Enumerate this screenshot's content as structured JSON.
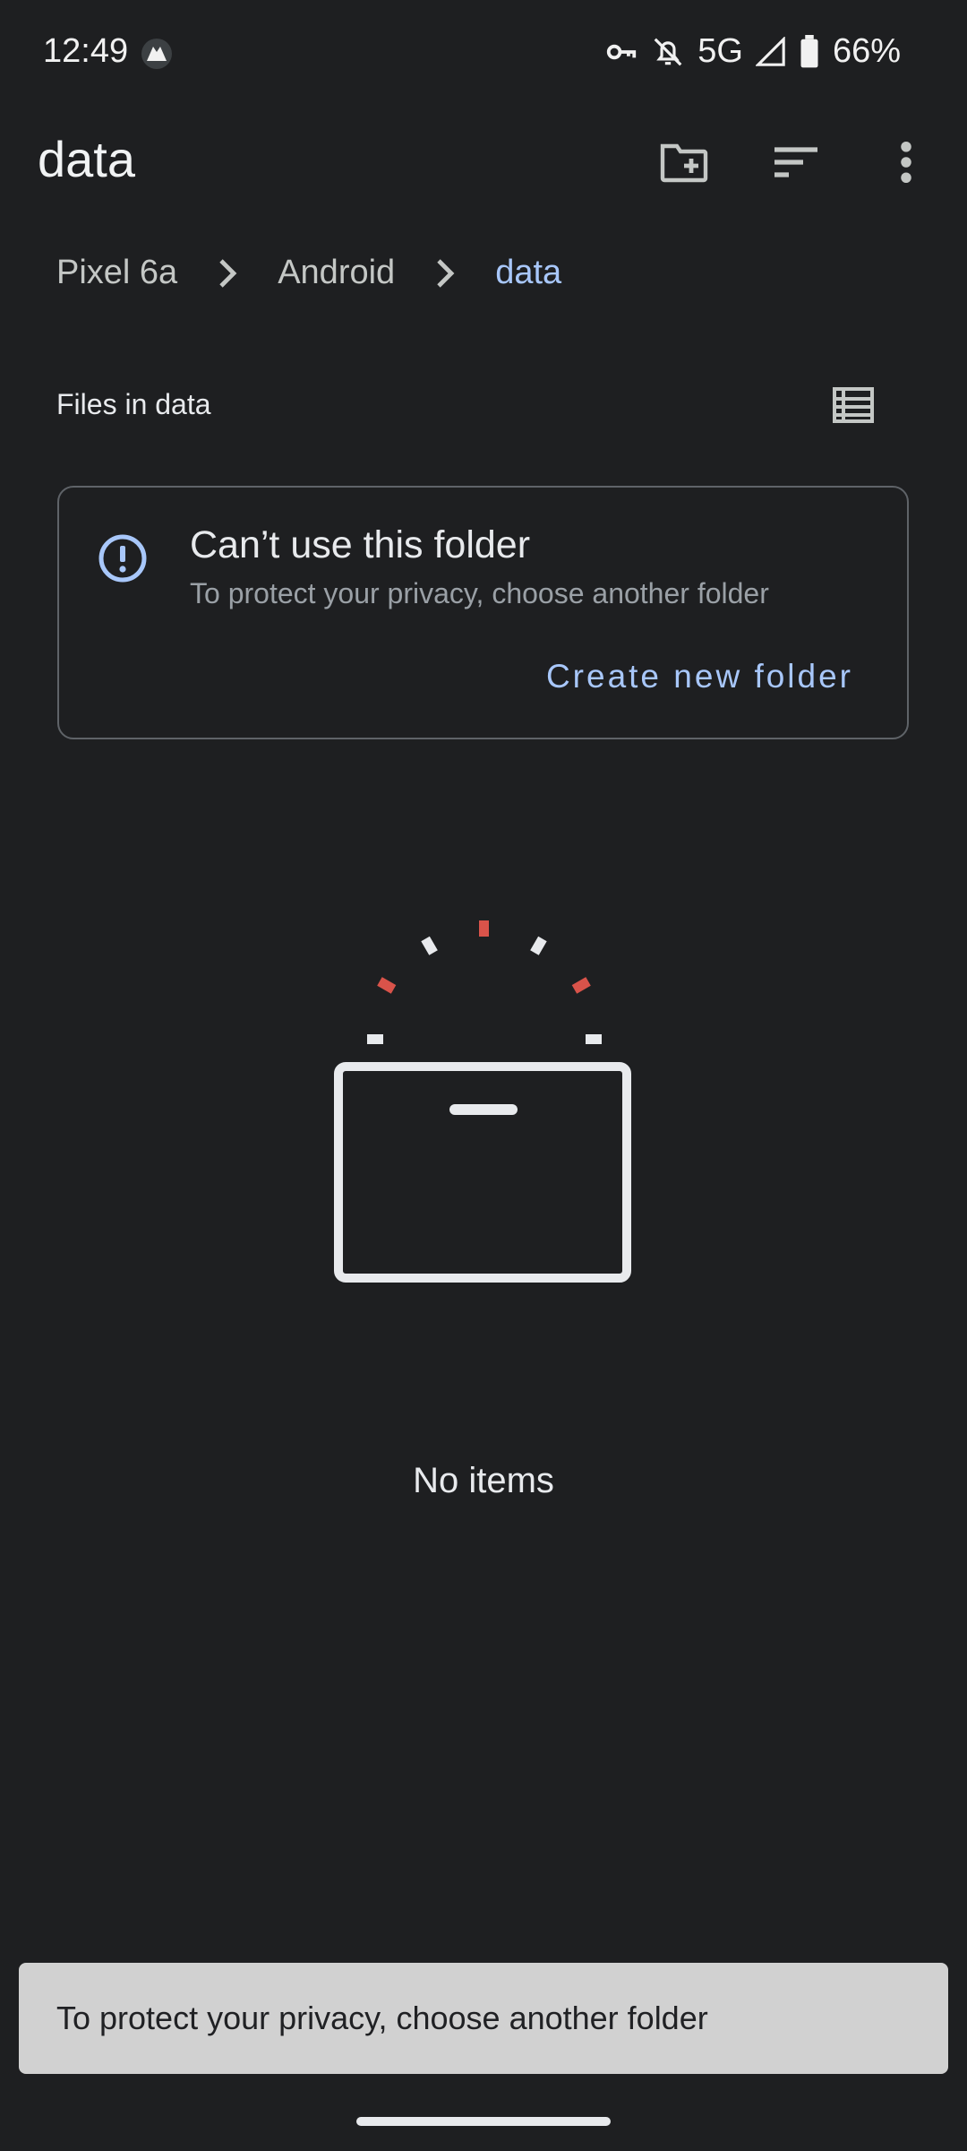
{
  "status_bar": {
    "time": "12:49",
    "network": "5G",
    "battery": "66%"
  },
  "app_bar": {
    "title": "data",
    "icons": [
      "new-folder-icon",
      "sort-icon",
      "more-vert-icon"
    ]
  },
  "breadcrumb": {
    "items": [
      "Pixel 6a",
      "Android",
      "data"
    ]
  },
  "files_section": {
    "heading": "Files in data"
  },
  "warning_card": {
    "title": "Can’t use this folder",
    "subtitle": "To protect your privacy, choose another folder",
    "action_label": "Create new folder"
  },
  "empty_state": {
    "text": "No items"
  },
  "snackbar": {
    "text": "To protect your privacy, choose another folder"
  },
  "colors": {
    "background": "#1e1f21",
    "accent": "#a8c7fa",
    "snackbar": "#d1d1d1",
    "spark_red": "#d9534a"
  }
}
